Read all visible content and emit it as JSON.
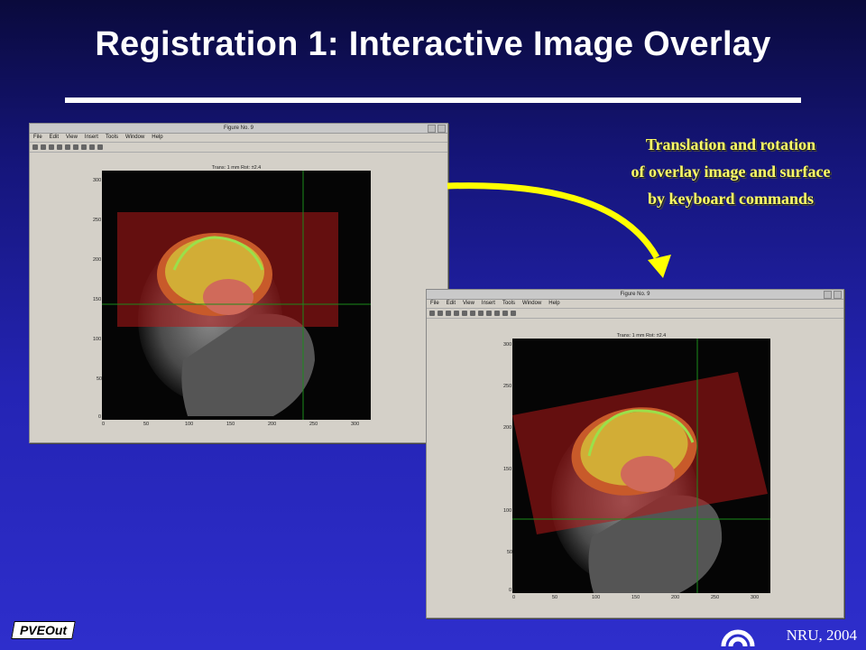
{
  "slide": {
    "title": "Registration 1: Interactive Image Overlay",
    "caption_lines": [
      "Translation and rotation",
      "of overlay image and surface",
      "by keyboard commands"
    ],
    "footer_right": "NRU, 2004",
    "logo_left": "PVEOut"
  },
  "figures": [
    {
      "window_title": "Figure No. 9",
      "menu": [
        "File",
        "Edit",
        "View",
        "Insert",
        "Tools",
        "Window",
        "Help"
      ],
      "plot_title": "Trans: 1 mm  Rot: ±2.4",
      "yticks": [
        "300",
        "250",
        "200",
        "150",
        "100",
        "50",
        "0"
      ],
      "xticks": [
        "0",
        "50",
        "100",
        "150",
        "200",
        "250",
        "300"
      ]
    },
    {
      "window_title": "Figure No. 9",
      "menu": [
        "File",
        "Edit",
        "View",
        "Insert",
        "Tools",
        "Window",
        "Help"
      ],
      "plot_title": "Trans: 1 mm  Rot: ±2.4",
      "yticks": [
        "300",
        "250",
        "200",
        "150",
        "100",
        "50",
        "0"
      ],
      "xticks": [
        "0",
        "50",
        "100",
        "150",
        "200",
        "250",
        "300"
      ]
    }
  ],
  "colors": {
    "title": "#ffffff",
    "caption": "#ffff66",
    "arrow": "#ffff00",
    "background_top": "#0a0a3c",
    "background_bottom": "#2e2ecc"
  }
}
